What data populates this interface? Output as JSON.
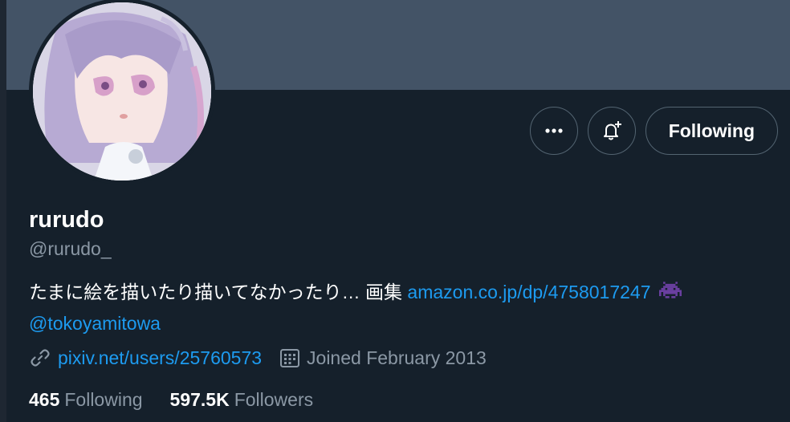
{
  "profile": {
    "name": "rurudo",
    "handle": "@rurudo_",
    "bio_text": "たまに絵を描いたり描いてなかったり… 画集",
    "bio_link": "amazon.co.jp/dp/4758017247",
    "bio_mention": "@tokoyamitowa",
    "website": "pixiv.net/users/25760573",
    "joined": "Joined February 2013",
    "following_count": "465",
    "following_label": "Following",
    "followers_count": "597.5K",
    "followers_label": "Followers"
  },
  "actions": {
    "more_icon": "more-dots-icon",
    "notify_icon": "bell-plus-icon",
    "follow_label": "Following"
  },
  "icons": {
    "link": "link-icon",
    "calendar": "calendar-icon",
    "bio_emoji": "space-invader-emoji"
  },
  "colors": {
    "background": "#15202b",
    "banner": "#435366",
    "accent": "#1d9bf0",
    "muted": "#8b98a5",
    "border": "#536471"
  }
}
